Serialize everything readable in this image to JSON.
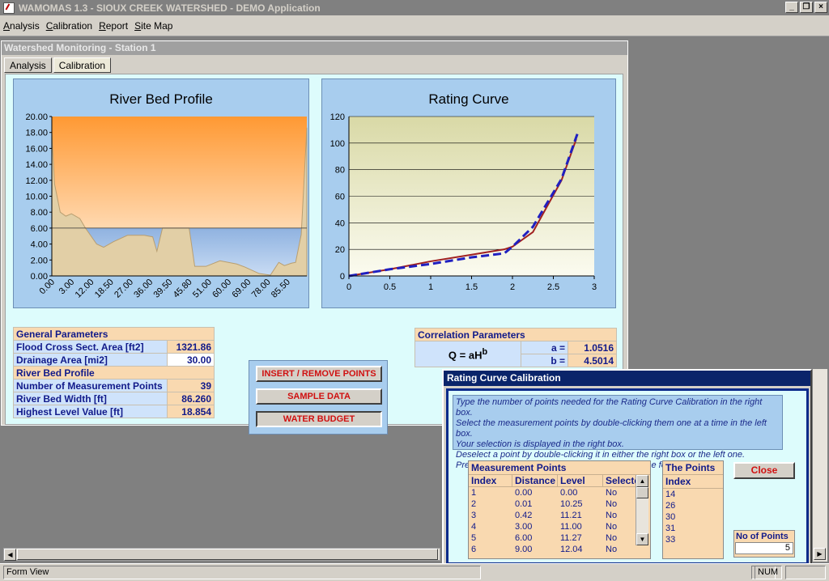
{
  "app": {
    "title": "WAMOMAS 1.3 - SIOUX CREEK WATERSHED - DEMO Application"
  },
  "menu": [
    "Analysis",
    "Calibration",
    "Report",
    "Site Map"
  ],
  "form": {
    "title": "Watershed Monitoring - Station 1",
    "tabs": [
      "Analysis",
      "Calibration"
    ]
  },
  "charts": [
    {
      "title": "River Bed Profile",
      "type": "area",
      "y_ticks": [
        "0.00",
        "2.00",
        "4.00",
        "6.00",
        "8.00",
        "10.00",
        "12.00",
        "14.00",
        "16.00",
        "18.00",
        "20.00"
      ],
      "x_ticks": [
        "0.00",
        "3.00",
        "12.00",
        "18.50",
        "27.00",
        "36.00",
        "39.50",
        "45.80",
        "51.00",
        "60.00",
        "69.00",
        "78.00",
        "85.50"
      ],
      "ylim": [
        0,
        20
      ],
      "water_level": 6.0,
      "profile": [
        [
          0,
          18.0
        ],
        [
          1,
          11.5
        ],
        [
          3,
          8.0
        ],
        [
          5,
          7.5
        ],
        [
          7,
          7.8
        ],
        [
          10,
          7.2
        ],
        [
          12,
          6.0
        ],
        [
          16,
          4.0
        ],
        [
          18.5,
          3.6
        ],
        [
          22,
          4.3
        ],
        [
          27,
          5.1
        ],
        [
          33,
          5.1
        ],
        [
          36,
          4.9
        ],
        [
          37.5,
          3.1
        ],
        [
          39.5,
          6.0
        ],
        [
          45.8,
          6.0
        ],
        [
          49,
          6.0
        ],
        [
          51,
          1.2
        ],
        [
          55,
          1.2
        ],
        [
          60,
          1.9
        ],
        [
          66,
          1.5
        ],
        [
          69,
          1.1
        ],
        [
          74,
          0.3
        ],
        [
          78,
          0.1
        ],
        [
          81,
          1.7
        ],
        [
          83,
          1.3
        ],
        [
          85.5,
          1.6
        ],
        [
          87,
          1.7
        ],
        [
          89,
          5.2
        ],
        [
          91,
          18.6
        ]
      ],
      "xlim": [
        0,
        91
      ]
    },
    {
      "title": "Rating Curve",
      "type": "line",
      "y_ticks": [
        "0",
        "20",
        "40",
        "60",
        "80",
        "100",
        "120"
      ],
      "x_ticks": [
        "0",
        "0.5",
        "1",
        "1.5",
        "2",
        "2.5",
        "3"
      ],
      "xlim": [
        0,
        3
      ],
      "ylim": [
        0,
        120
      ],
      "series": [
        {
          "color": "#a02020",
          "dash": false,
          "x": [
            0,
            0.5,
            1,
            1.5,
            1.9,
            2.0,
            2.25,
            2.6,
            2.78
          ],
          "y": [
            0,
            5,
            11,
            16,
            20,
            22,
            33,
            72,
            103
          ]
        },
        {
          "color": "#2020c0",
          "dash": true,
          "x": [
            0,
            0.5,
            1,
            1.5,
            1.9,
            2.0,
            2.25,
            2.6,
            2.8
          ],
          "y": [
            0,
            5,
            9,
            14,
            17,
            22,
            37,
            73,
            108
          ]
        }
      ]
    }
  ],
  "general": {
    "header": "General Parameters",
    "rows": [
      {
        "label": "Flood Cross Sect. Area  [ft2]",
        "value": "1321.86"
      },
      {
        "label": "Drainage Area [mi2]",
        "value": "30.00"
      }
    ],
    "profile_header": "River Bed Profile",
    "profile_rows": [
      {
        "label": "Number of Measurement Points",
        "value": "39"
      },
      {
        "label": "River Bed Width [ft]",
        "value": "86.260"
      },
      {
        "label": "Highest Level Value [ft]",
        "value": "18.854"
      }
    ]
  },
  "buttons": [
    "INSERT / REMOVE POINTS",
    "SAMPLE DATA",
    "WATER BUDGET"
  ],
  "correlation": {
    "header": "Correlation Parameters",
    "formula": "Q = aH",
    "exp": "b",
    "a_label": "a =",
    "a": "1.0516",
    "b_label": "b =",
    "b": "4.5014"
  },
  "dialog": {
    "title": "Rating Curve Calibration",
    "instructions": [
      "Type the number of points needed for the Rating Curve Calibration in the right box.",
      "Select the measurement points by double-clicking them one at a time in the left box.",
      "Your selection is displayed in the right box.",
      "Deselect a point by double-clicking it in either the right box or the left one.",
      "Press CLOSE to store your selection and close the form."
    ],
    "mp_title": "Measurement Points",
    "mp_cols": [
      "Index",
      "Distance",
      "Level",
      "Selected"
    ],
    "mp_rows": [
      [
        "1",
        "0.00",
        "0.00",
        "No"
      ],
      [
        "2",
        "0.01",
        "10.25",
        "No"
      ],
      [
        "3",
        "0.42",
        "11.21",
        "No"
      ],
      [
        "4",
        "3.00",
        "11.00",
        "No"
      ],
      [
        "5",
        "6.00",
        "11.27",
        "No"
      ],
      [
        "6",
        "9.00",
        "12.04",
        "No"
      ]
    ],
    "tp_title": "The Points",
    "tp_col": "Index",
    "tp_rows": [
      "14",
      "26",
      "30",
      "31",
      "33"
    ],
    "close": "Close",
    "nop_label": "No of Points",
    "nop_value": "5"
  },
  "status": {
    "form": "Form View",
    "num": "NUM"
  }
}
